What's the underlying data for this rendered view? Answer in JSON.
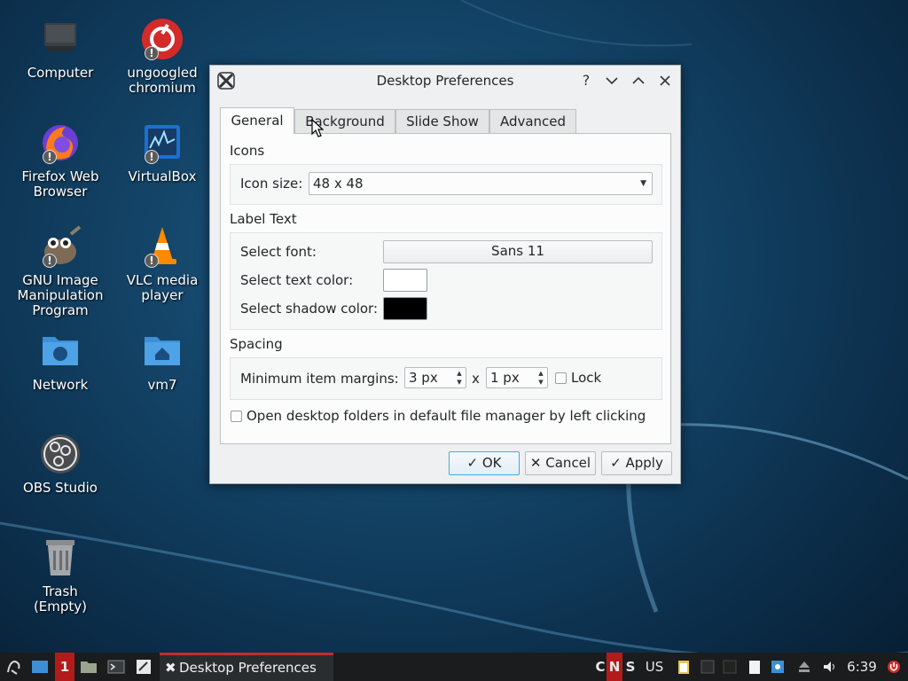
{
  "desktop": {
    "icons": [
      {
        "label": "Computer"
      },
      {
        "label": "ungoogled\nchromium"
      },
      {
        "label": "Firefox Web\nBrowser"
      },
      {
        "label": "VirtualBox"
      },
      {
        "label": "GNU Image\nManipulation\nProgram"
      },
      {
        "label": "VLC media\nplayer"
      },
      {
        "label": "Network"
      },
      {
        "label": "vm7"
      },
      {
        "label": "OBS Studio"
      },
      {
        "label": "Trash\n(Empty)"
      }
    ],
    "badge": "!"
  },
  "dialog": {
    "title": "Desktop Preferences",
    "help_glyph": "?",
    "tabs": [
      "General",
      "Background",
      "Slide Show",
      "Advanced"
    ],
    "icons_group": {
      "title": "Icons",
      "icon_size_label": "Icon size:",
      "icon_size_value": "48 x 48"
    },
    "label_text_group": {
      "title": "Label Text",
      "font_label": "Select font:",
      "font_value": "Sans 11",
      "text_color_label": "Select text color:",
      "text_color": "#ffffff",
      "shadow_color_label": "Select shadow color:",
      "shadow_color": "#000000"
    },
    "spacing_group": {
      "title": "Spacing",
      "margins_label": "Minimum item margins:",
      "margin_x": "3 px",
      "times": "x",
      "margin_y": "1 px",
      "lock_label": "Lock"
    },
    "open_folders_label": "Open desktop folders in default file manager by left clicking",
    "buttons": {
      "ok": "OK",
      "cancel": "Cancel",
      "apply": "Apply"
    }
  },
  "taskbar": {
    "workspace": "1",
    "task_label": "Desktop Preferences",
    "indicators": [
      "C",
      "N",
      "S"
    ],
    "keyboard_layout": "US",
    "clock": "6:39"
  },
  "colors": {
    "accent": "#3daee9",
    "task_active": "#c22d2d",
    "num_lock": "#b31b1b"
  }
}
